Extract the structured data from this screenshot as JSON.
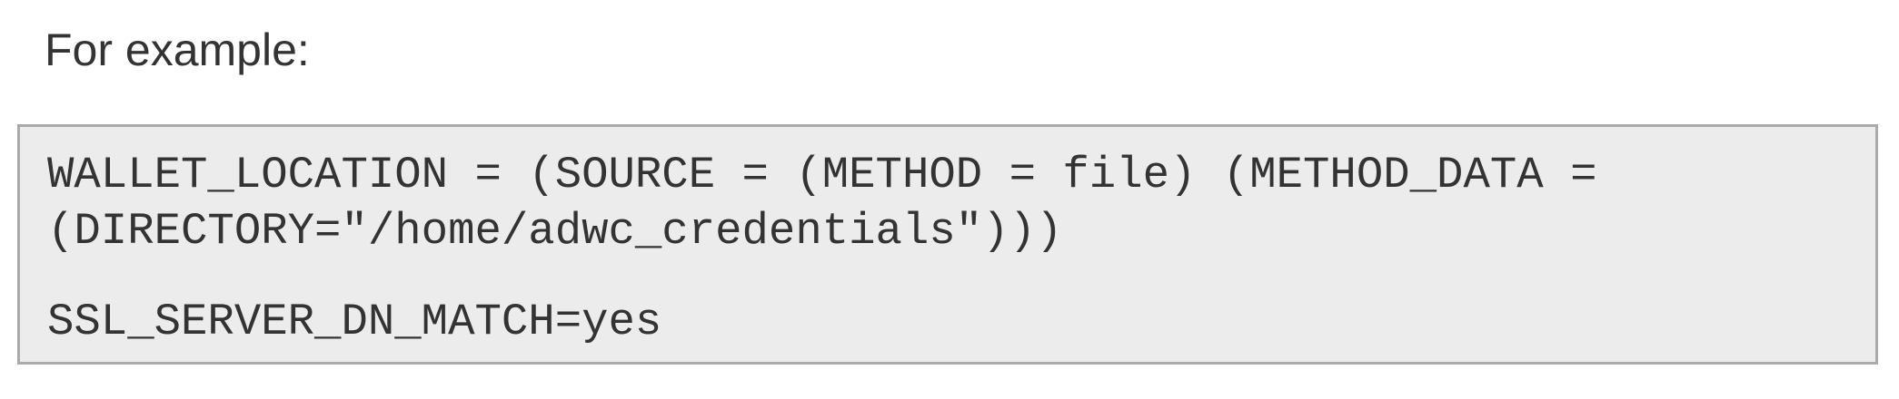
{
  "intro_text": "For example:",
  "code_block": {
    "lines": [
      "WALLET_LOCATION = (SOURCE = (METHOD = file) (METHOD_DATA = (DIRECTORY=\"/home/adwc_credentials\")))",
      "SSL_SERVER_DN_MATCH=yes"
    ]
  },
  "colors": {
    "text": "#333333",
    "code_background": "#ececec",
    "code_border": "#aaaaaa"
  }
}
